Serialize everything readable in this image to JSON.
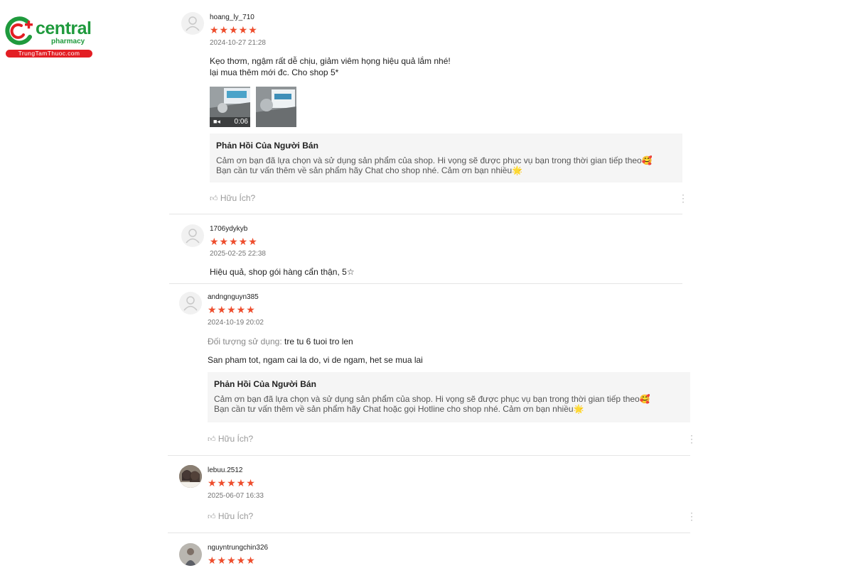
{
  "brand": {
    "name": "central",
    "sub": "pharmacy",
    "url": "TrungTamThuoc.com",
    "colors": {
      "green": "#1f9a3d",
      "red": "#e31e24"
    }
  },
  "colors": {
    "star": "#ee4d2d",
    "reply_bg": "#f5f5f5",
    "divider": "#e5e5e5"
  },
  "helpful_label": "Hữu Ích?",
  "reply_title": "Phản Hồi Của Người Bán",
  "reviews": [
    {
      "username": "hoang_ly_710",
      "stars": "★★★★★",
      "date": "2024-10-27 21:28",
      "text": "Kẹo thơm, ngậm rất dễ chịu, giảm viêm họng hiệu quả lắm nhé!\n lại mua thêm mới đc. Cho shop 5*",
      "video_duration": "0:06",
      "reply": "Cảm ơn bạn đã lựa chọn và sử dụng sản phẩm của shop. Hi vọng sẽ được phục vụ bạn trong thời gian tiếp theo🥰\nBạn cần tư vấn thêm về sản phẩm hãy Chat cho shop nhé. Cảm ơn bạn nhiều🌟"
    },
    {
      "username": "1706ydykyb",
      "stars": "★★★★★",
      "date": "2025-02-25 22:38",
      "text": "Hiệu quả, shop gói hàng cẩn thận, 5☆"
    },
    {
      "username": "andngnguyn385",
      "stars": "★★★★★",
      "date": "2024-10-19 20:02",
      "meta_label": "Đối tượng sử dụng:",
      "meta_value": "tre tu 6 tuoi tro len",
      "text": "San pham tot, ngam cai la do, vi de ngam, het se mua lai",
      "reply": "Cảm ơn bạn đã lựa chọn và sử dụng sản phẩm của shop. Hi vọng sẽ được phục vụ bạn trong thời gian tiếp theo🥰\nBạn cần tư vấn thêm về sản phẩm hãy Chat hoặc gọi Hotline cho shop nhé. Cảm ơn bạn nhiều🌟"
    },
    {
      "username": "lebuu.2512",
      "stars": "★★★★★",
      "date": "2025-06-07 16:33"
    },
    {
      "username": "nguyntrungchin326",
      "stars": "★★★★★"
    }
  ]
}
